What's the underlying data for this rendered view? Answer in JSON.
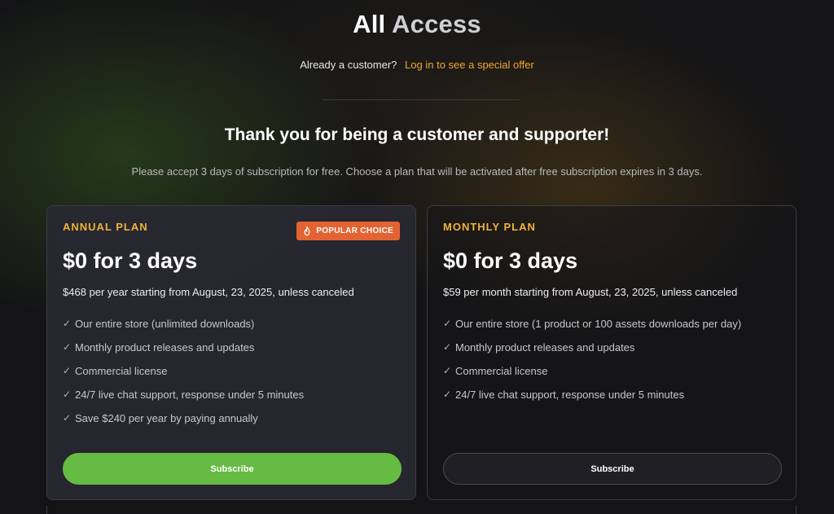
{
  "header": {
    "title_part1": "All",
    "title_part2": "Access",
    "login_question": "Already a customer?",
    "login_link": "Log in to see a special offer"
  },
  "intro": {
    "heading": "Thank you for being a customer and supporter!",
    "subtext": "Please accept 3 days of subscription for free. Choose a plan that will be activated after free subscription expires in 3 days."
  },
  "plans": [
    {
      "name": "ANNUAL PLAN",
      "badge": "POPULAR CHOICE",
      "badge_icon": "fire-icon",
      "price": "$0 for 3 days",
      "terms": "$468 per year starting from August, 23, 2025, unless canceled",
      "features": [
        "Our entire store (unlimited downloads)",
        "Monthly product releases and updates",
        "Commercial license",
        "24/7 live chat support, response under 5 minutes",
        "Save $240 per year by paying annually"
      ],
      "button": "Subscribe"
    },
    {
      "name": "MONTHLY PLAN",
      "price": "$0 for 3 days",
      "terms": "$59 per month starting from August, 23, 2025, unless canceled",
      "features": [
        "Our entire store (1 product or 100 assets downloads per day)",
        "Monthly product releases and updates",
        "Commercial license",
        "24/7 live chat support, response under 5 minutes"
      ],
      "button": "Subscribe"
    }
  ],
  "colors": {
    "accent_orange": "#f0a630",
    "plan_label": "#f0b23a",
    "badge": "#e36432",
    "subscribe_green": "#66bb43",
    "background": "#141416"
  }
}
